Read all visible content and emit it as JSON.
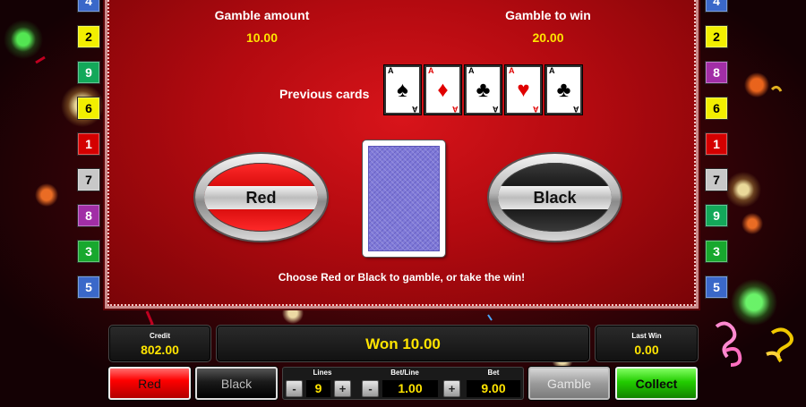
{
  "panel": {
    "gamble_amount_label": "Gamble amount",
    "gamble_amount_value": "10.00",
    "gamble_to_win_label": "Gamble to win",
    "gamble_to_win_value": "20.00",
    "previous_cards_label": "Previous cards",
    "previous_cards": [
      {
        "rank": "A",
        "suit": "♠",
        "color": "#000000"
      },
      {
        "rank": "A",
        "suit": "♦",
        "color": "#e00000"
      },
      {
        "rank": "A",
        "suit": "♣",
        "color": "#000000"
      },
      {
        "rank": "A",
        "suit": "♥",
        "color": "#e00000"
      },
      {
        "rank": "A",
        "suit": "♣",
        "color": "#000000"
      }
    ],
    "choose_red_label": "Red",
    "choose_black_label": "Black",
    "hint": "Choose Red or Black to gamble, or take the win!"
  },
  "left_lines": [
    {
      "n": "4",
      "bg": "#3a68c9",
      "fg": "#ffffff"
    },
    {
      "n": "2",
      "bg": "#f2ef00",
      "fg": "#000000"
    },
    {
      "n": "9",
      "bg": "#13a85a",
      "fg": "#ffffff"
    },
    {
      "n": "6",
      "bg": "#f2ef00",
      "fg": "#000000"
    },
    {
      "n": "1",
      "bg": "#d40000",
      "fg": "#ffffff"
    },
    {
      "n": "7",
      "bg": "#c8c8c8",
      "fg": "#000000"
    },
    {
      "n": "8",
      "bg": "#a12ea6",
      "fg": "#ffffff"
    },
    {
      "n": "3",
      "bg": "#18a82e",
      "fg": "#ffffff"
    },
    {
      "n": "5",
      "bg": "#3a68c9",
      "fg": "#ffffff"
    }
  ],
  "right_lines": [
    {
      "n": "4",
      "bg": "#3a68c9",
      "fg": "#ffffff"
    },
    {
      "n": "2",
      "bg": "#f2ef00",
      "fg": "#000000"
    },
    {
      "n": "8",
      "bg": "#a12ea6",
      "fg": "#ffffff"
    },
    {
      "n": "6",
      "bg": "#f2ef00",
      "fg": "#000000"
    },
    {
      "n": "1",
      "bg": "#d40000",
      "fg": "#ffffff"
    },
    {
      "n": "7",
      "bg": "#c8c8c8",
      "fg": "#000000"
    },
    {
      "n": "9",
      "bg": "#13a85a",
      "fg": "#ffffff"
    },
    {
      "n": "3",
      "bg": "#18a82e",
      "fg": "#ffffff"
    },
    {
      "n": "5",
      "bg": "#3a68c9",
      "fg": "#ffffff"
    }
  ],
  "info": {
    "credit_label": "Credit",
    "credit_value": "802.00",
    "message": "Won 10.00",
    "last_win_label": "Last Win",
    "last_win_value": "0.00"
  },
  "controls": {
    "red_label": "Red",
    "black_label": "Black",
    "lines_label": "Lines",
    "lines_value": "9",
    "bet_line_label": "Bet/Line",
    "bet_line_value": "1.00",
    "bet_label": "Bet",
    "bet_value": "9.00",
    "minus": "-",
    "plus": "+",
    "gamble_label": "Gamble",
    "collect_label": "Collect"
  }
}
